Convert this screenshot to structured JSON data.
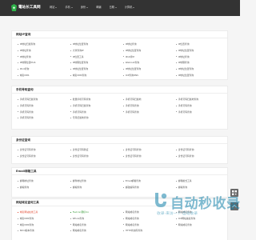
{
  "header": {
    "logo_text": "電站长工具网",
    "nav": [
      {
        "label": "网站",
        "caret": true
      },
      {
        "label": "手机",
        "caret": true
      },
      {
        "label": "身份",
        "caret": true
      },
      {
        "label": "邮编",
        "caret": false
      },
      {
        "label": "日期",
        "caret": true
      },
      {
        "label": "计算机",
        "caret": true
      }
    ]
  },
  "sections": [
    {
      "title": "网站IP查询",
      "links": [
        {
          "text": "IP地址归属查询"
        },
        {
          "text": "IP地址位置查询"
        },
        {
          "text": "IP地址查询"
        },
        {
          "text": "IP位置查询"
        },
        {
          "text": "IP地址查询"
        },
        {
          "text": "大米查询IP"
        },
        {
          "text": "IP地址位置查询"
        },
        {
          "text": "IP地址位置查询"
        },
        {
          "text": "IP地址查询"
        },
        {
          "text": "IP位置工具"
        },
        {
          "text": "IPv6查IP"
        },
        {
          "text": "IP地址查询"
        },
        {
          "text": "IP地理位置IPv6"
        },
        {
          "text": "IP地理位置查询"
        },
        {
          "text": "Webroot查询"
        },
        {
          "text": "IP地理查询"
        },
        {
          "text": "IPv4查询"
        },
        {
          "text": "IP地址位置查询"
        },
        {
          "text": "IP地址位置查询"
        },
        {
          "text": "IP地址位置查询"
        },
        {
          "text": "域名DNS"
        },
        {
          "text": "域名DNS查询"
        },
        {
          "text": "ICP查询DNS"
        },
        {
          "text": "IP地址位置查询"
        }
      ]
    },
    {
      "title": "手机号码查询",
      "links": [
        {
          "text": "手机号码归属查询"
        },
        {
          "text": "批量手机号码查询"
        },
        {
          "text": "手机号码归属地"
        },
        {
          "text": "手机号码归属地查询"
        },
        {
          "text": "手机号码查询"
        },
        {
          "text": "手机号码归属查询"
        },
        {
          "text": "手机号码查询"
        },
        {
          "text": "手机号码查询"
        },
        {
          "text": "手机号码查询"
        },
        {
          "text": "手机号码查询"
        },
        {
          "text": "手机号码查询"
        },
        {
          "text": "手机号码查询"
        },
        {
          "text": "手机号码查询"
        },
        {
          "text": "号码归属地查询"
        },
        {
          "text": "",
          "hidden": true
        },
        {
          "text": "",
          "hidden": true
        }
      ]
    },
    {
      "title": "身份证查询",
      "links": [
        {
          "text": "身份证号码查询"
        },
        {
          "text": "身份证号码验证"
        },
        {
          "text": "身份证号码查询"
        },
        {
          "text": "身份证号码查询"
        },
        {
          "text": "身份证号码查询"
        },
        {
          "text": "身份证号码查询"
        },
        {
          "text": "身份证号码查询"
        },
        {
          "text": "身份证号码查询"
        }
      ]
    },
    {
      "title": "Email邮箱工具",
      "links": [
        {
          "text": "邮箱地址查询"
        },
        {
          "text": "邮件地址查询"
        },
        {
          "text": "Email邮箱查询"
        },
        {
          "text": "邮箱格式工具"
        },
        {
          "text": "邮编查询"
        },
        {
          "text": "邮编查询"
        },
        {
          "text": "邮政编码查询"
        },
        {
          "text": "邮编查询"
        }
      ]
    },
    {
      "title": "网站域名查询工具",
      "links": [
        {
          "text": "域名网站在线工具",
          "style": "red"
        },
        {
          "text": "Favicon图标Ico",
          "style": "green"
        },
        {
          "text": "网站域名查询"
        },
        {
          "text": "网站域名查询"
        },
        {
          "text": "域名DNS查询"
        },
        {
          "text": "Whois查询"
        },
        {
          "text": "网站域名查询"
        },
        {
          "text": "ICP网站备案查询"
        },
        {
          "text": "域名DNS查询"
        },
        {
          "text": "网站域名查询"
        },
        {
          "text": "网站域名查询"
        },
        {
          "text": "网站域名查询"
        },
        {
          "text": "Ntml版本查询"
        },
        {
          "text": "网站域名查询"
        },
        {
          "text": "HTTP状态码查询"
        },
        {
          "text": "",
          "hidden": true
        }
      ]
    }
  ],
  "watermark": {
    "title": "自动秒收录",
    "subtitle": "收录·来访一个·自动收录"
  },
  "colors": {
    "header_bg": "#333333",
    "accent_green": "#2fb34a",
    "link_red": "#e0452d",
    "link_green": "#3a9b3a",
    "watermark_blue": "#1482aa"
  }
}
